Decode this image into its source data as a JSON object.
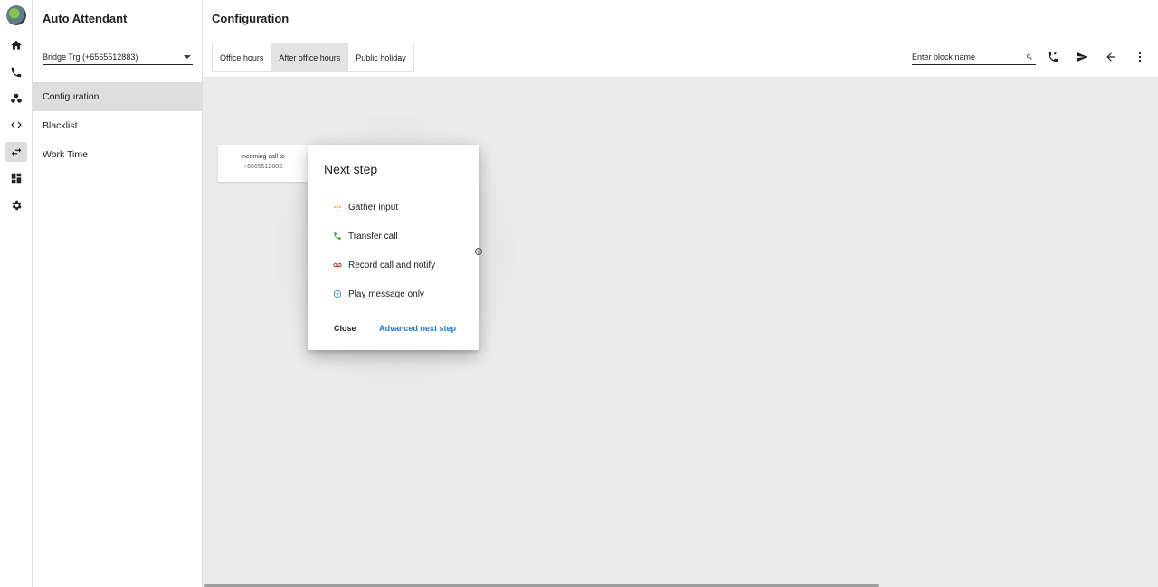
{
  "rail": {
    "items": [
      "avatar",
      "home-icon",
      "phone-icon",
      "contacts-icon",
      "code-icon",
      "swap-icon",
      "dashboard-icon",
      "gear-icon"
    ],
    "active": "swap-icon"
  },
  "sidebar": {
    "title": "Auto Attendant",
    "select_value": "Bridge Trg (+6565512883)",
    "items": [
      {
        "label": "Configuration",
        "active": true
      },
      {
        "label": "Blacklist",
        "active": false
      },
      {
        "label": "Work Time",
        "active": false
      }
    ]
  },
  "header": {
    "title": "Configuration",
    "tabs": [
      {
        "label": "Office hours",
        "active": false
      },
      {
        "label": "After office hours",
        "active": true
      },
      {
        "label": "Public holiday",
        "active": false
      }
    ],
    "search": {
      "placeholder": "Enter block name",
      "value": ""
    }
  },
  "canvas": {
    "start_node": {
      "line1": "Incoming call to",
      "line2": "+6565512883"
    }
  },
  "dialog": {
    "title": "Next step",
    "options": [
      {
        "label": "Gather input",
        "icon": "gather-icon",
        "color": "#e0a020"
      },
      {
        "label": "Transfer call",
        "icon": "phone-icon",
        "color": "#2e9d4a"
      },
      {
        "label": "Record call and notify",
        "icon": "voicemail-icon",
        "color": "#c0392b"
      },
      {
        "label": "Play message only",
        "icon": "play-icon",
        "color": "#1e88c8"
      }
    ],
    "close_label": "Close",
    "advanced_label": "Advanced next step"
  },
  "colors": {
    "accent": "#1976d2",
    "canvas": "#ebebeb"
  }
}
